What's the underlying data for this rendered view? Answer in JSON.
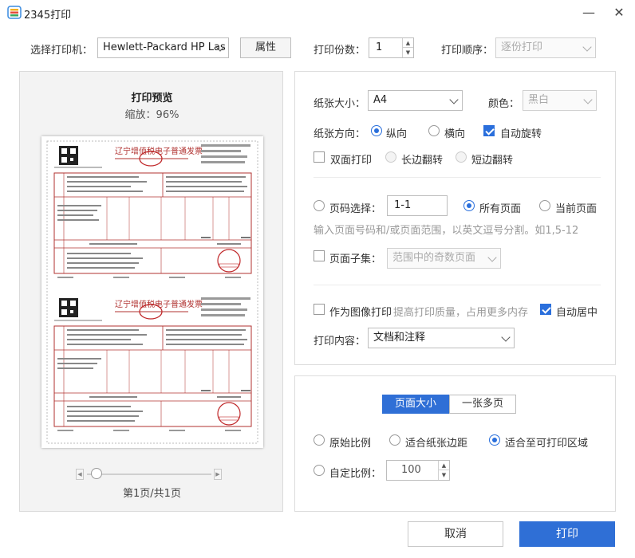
{
  "window": {
    "title": "2345打印",
    "minimize_symbol": "—",
    "close_symbol": "✕"
  },
  "printer": {
    "label": "选择打印机：",
    "selected": "Hewlett-Packard HP Las",
    "properties_label": "属性"
  },
  "copies": {
    "label": "打印份数：",
    "value": "1"
  },
  "order": {
    "label": "打印顺序：",
    "selected": "逐份打印"
  },
  "preview": {
    "title": "打印预览",
    "zoom": "缩放：96%",
    "page_count": "第1页/共1页",
    "slider_position": 0
  },
  "paper": {
    "size_label": "纸张大小：",
    "size_selected": "A4",
    "color_label": "颜色：",
    "color_selected": "黑白",
    "orientation_label": "纸张方向：",
    "portrait_label": "纵向",
    "landscape_label": "横向",
    "auto_rotate_label": "自动旋转",
    "orientation": "portrait",
    "auto_rotate": true
  },
  "duplex": {
    "label": "双面打印",
    "long_edge_label": "长边翻转",
    "short_edge_label": "短边翻转",
    "enabled": false
  },
  "pages": {
    "range_label": "页码选择：",
    "range_value": "1-1",
    "all_pages_label": "所有页面",
    "current_page_label": "当前页面",
    "hint": "输入页面号码和/或页面范围，以英文逗号分割。如1,5-12",
    "subset_label": "页面子集：",
    "subset_selected": "范围中的奇数页面",
    "selection": "all"
  },
  "image_print": {
    "label": "作为图像打印",
    "hint": "提高打印质量，占用更多内存",
    "enabled": false,
    "auto_center_label": "自动居中",
    "auto_center": true
  },
  "content": {
    "label": "打印内容：",
    "selected": "文档和注释"
  },
  "scaling": {
    "tab_page_size": "页面大小",
    "tab_multi_page": "一张多页",
    "original_label": "原始比例",
    "fit_margins_label": "适合纸张边距",
    "fit_printable_label": "适合至可打印区域",
    "custom_label": "自定比例：",
    "custom_value": "100",
    "selection": "fit_printable"
  },
  "actions": {
    "cancel_label": "取消",
    "print_label": "打印"
  },
  "invoice": {
    "title": "辽宁增值税电子普通发票",
    "seal_text": "发票专用章"
  },
  "colors": {
    "accent": "#2f6fd6",
    "invoice_red": "#b0312f"
  }
}
